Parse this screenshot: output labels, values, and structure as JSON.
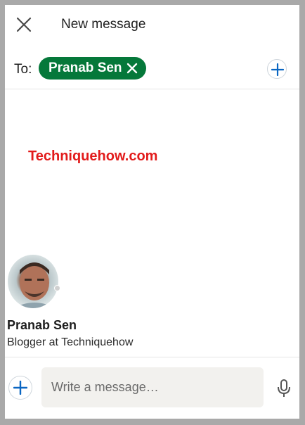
{
  "header": {
    "title": "New message",
    "close_icon": "close-icon"
  },
  "recipients": {
    "to_label": "To:",
    "chips": [
      {
        "label": "Pranab Sen",
        "remove_icon": "close-icon"
      }
    ],
    "add_icon": "plus-icon"
  },
  "watermark": "Techniquehow.com",
  "profile": {
    "name": "Pranab Sen",
    "headline": "Blogger at Techniquehow"
  },
  "composer": {
    "attach_icon": "plus-icon",
    "placeholder": "Write a message…",
    "mic_icon": "microphone-icon"
  },
  "colors": {
    "chip_green": "#05783a",
    "accent_blue": "#0a66c2",
    "watermark_red": "#e21b1b"
  }
}
